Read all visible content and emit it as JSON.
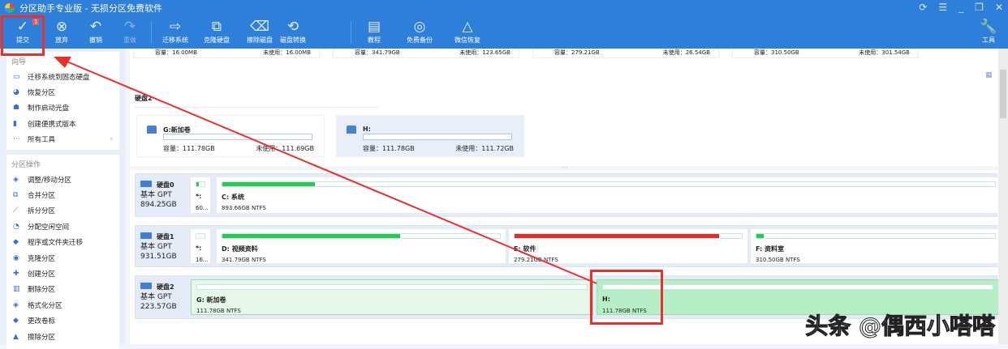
{
  "title": "分区助手专业版 - 无损分区免费软件",
  "window_controls": [
    "refresh-icon",
    "menu-icon",
    "minimize-icon",
    "restore-icon",
    "close-icon"
  ],
  "toolbar": {
    "submit": "提交",
    "submit_badge": "1",
    "discard": "放弃",
    "undo": "撤销",
    "redo": "重做",
    "migrate": "迁移系统",
    "clone": "克隆硬盘",
    "wipe": "擦除磁盘",
    "convert": "磁盘转换",
    "tutorial": "教程",
    "backup": "免费备份",
    "recover": "微信恢复",
    "tools": "工具"
  },
  "sidebar": {
    "wizard_title": "向导",
    "wizard": [
      "迁移系统到固态硬盘",
      "恢复分区",
      "制作启动光盘",
      "创建便携式版本",
      "所有工具"
    ],
    "ops_title": "分区操作",
    "ops": [
      "调整/移动分区",
      "合并分区",
      "拆分分区",
      "分配空闲空间",
      "程序或文件夹迁移",
      "克隆分区",
      "创建分区",
      "删除分区",
      "格式化分区",
      "更改卷标",
      "擦除分区"
    ]
  },
  "top_cards": [
    {
      "cap": "容量：16.00MB",
      "free": "未使用：16.00MB"
    },
    {
      "cap": "容量：341.79GB",
      "free": "未使用：123.65GB"
    },
    {
      "cap": "容量：279.21GB",
      "free": "未使用：26.54GB"
    },
    {
      "cap": "容量：310.50GB",
      "free": "未使用：301.54GB"
    }
  ],
  "disk2_section": {
    "title": "硬盘2",
    "cards": [
      {
        "name": "G:新加卷",
        "cap": "容量：111.78GB",
        "free": "未使用：111.69GB"
      },
      {
        "name": "H:",
        "cap": "容量：111.78GB",
        "free": "未使用：111.72GB"
      }
    ]
  },
  "disks": [
    {
      "name": "硬盘0",
      "type": "基本 GPT",
      "size": "894.25GB",
      "parts": [
        {
          "name": "*:",
          "size": "60...",
          "used": 0.3,
          "color": "#22cc55"
        },
        {
          "name": "C: 系统",
          "size": "893.66GB NTFS",
          "used": 0.12,
          "color": "#22cc55"
        }
      ]
    },
    {
      "name": "硬盘1",
      "type": "基本 GPT",
      "size": "931.51GB",
      "parts": [
        {
          "name": "*:",
          "size": "16...",
          "used": 0,
          "color": "#ddd"
        },
        {
          "name": "D: 视频资料",
          "size": "341.79GB NTFS",
          "used": 0.64,
          "color": "#22cc55"
        },
        {
          "name": "E: 软件",
          "size": "279.21GB NTFS",
          "used": 0.9,
          "color": "#dd2e2e"
        },
        {
          "name": "F: 资料室",
          "size": "310.50GB NTFS",
          "used": 0.03,
          "color": "#22cc55"
        }
      ]
    },
    {
      "name": "硬盘2",
      "type": "基本 GPT",
      "size": "223.57GB",
      "parts": [
        {
          "name": "G: 新加卷",
          "size": "111.78GB NTFS",
          "used": 0,
          "color": "#22cc55"
        },
        {
          "name": "H:",
          "size": "111.78GB NTFS",
          "used": 0,
          "color": "#22cc55"
        }
      ]
    }
  ],
  "watermark": "头条 @偶西小嗒嗒"
}
